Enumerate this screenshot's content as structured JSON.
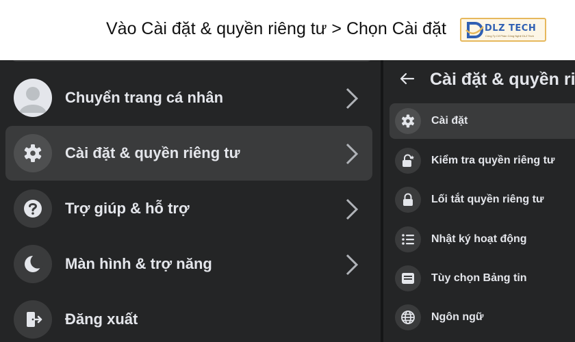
{
  "caption": {
    "text": "Vào Cài đặt & quyền riêng tư > Chọn Cài đặt"
  },
  "logo": {
    "letter": "D",
    "word": "DLZ TECH",
    "tagline": "Công Ty Cổ Phần Công Nghệ DLZ Tech"
  },
  "left_menu": {
    "items": [
      {
        "label": "Chuyển trang cá nhân",
        "icon": "avatar",
        "active": false
      },
      {
        "label": "Cài đặt & quyền riêng tư",
        "icon": "gear-icon",
        "active": true
      },
      {
        "label": "Trợ giúp & hỗ trợ",
        "icon": "question-icon",
        "active": false
      },
      {
        "label": "Màn hình & trợ năng",
        "icon": "moon-icon",
        "active": false
      },
      {
        "label": "Đăng xuất",
        "icon": "logout-icon",
        "active": false
      }
    ]
  },
  "settings_panel": {
    "title": "Cài đặt & quyền riêng tư",
    "items": [
      {
        "label": "Cài đặt",
        "icon": "gear-icon",
        "active": true
      },
      {
        "label": "Kiểm tra quyền riêng tư",
        "icon": "lock-check-icon",
        "active": false
      },
      {
        "label": "Lối tắt quyền riêng tư",
        "icon": "lock-icon",
        "active": false
      },
      {
        "label": "Nhật ký hoạt động",
        "icon": "list-icon",
        "active": false
      },
      {
        "label": "Tùy chọn Bảng tin",
        "icon": "feed-icon",
        "active": false
      },
      {
        "label": "Ngôn ngữ",
        "icon": "globe-icon",
        "active": false
      }
    ]
  },
  "colors": {
    "panel_bg": "#242526",
    "highlight": "#3a3b3c",
    "text": "#e4e6eb",
    "logo_blue": "#2f5fb3",
    "logo_gold": "#e6b85c"
  }
}
